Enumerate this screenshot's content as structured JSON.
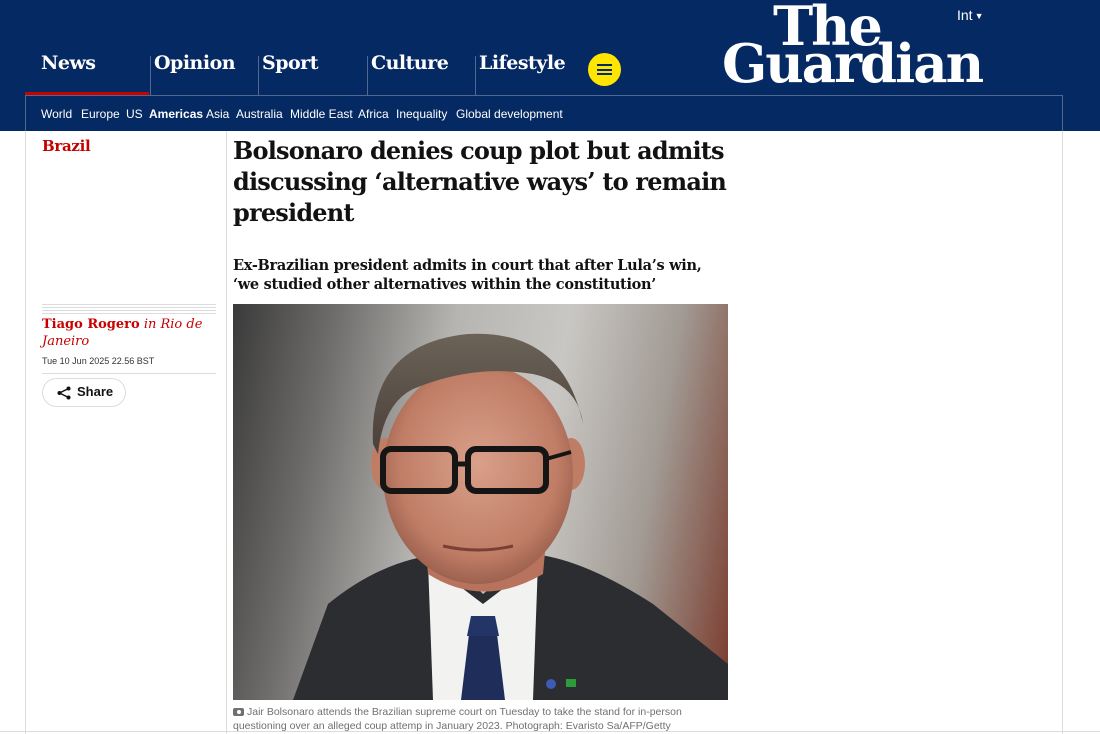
{
  "header": {
    "edition": "Int",
    "logo_line1": "The",
    "logo_line2": "Guardian",
    "colors": {
      "brand": "#052962",
      "news_accent": "#c70000",
      "menu_button": "#ffe500"
    },
    "pillars": [
      {
        "label": "News",
        "active": true
      },
      {
        "label": "Opinion"
      },
      {
        "label": "Sport"
      },
      {
        "label": "Culture"
      },
      {
        "label": "Lifestyle"
      }
    ],
    "menu_icon": "hamburger-icon",
    "subnav": [
      {
        "label": "World"
      },
      {
        "label": "Europe"
      },
      {
        "label": "US"
      },
      {
        "label": "Americas",
        "active": true
      },
      {
        "label": "Asia"
      },
      {
        "label": "Australia"
      },
      {
        "label": "Middle East"
      },
      {
        "label": "Africa"
      },
      {
        "label": "Inequality"
      },
      {
        "label": "Global development"
      }
    ]
  },
  "article": {
    "section": "Brazil",
    "headline": "Bolsonaro denies coup plot but admits discussing ‘alternative ways’ to remain president",
    "standfirst": "Ex-Brazilian president admits in court that after Lula’s win, ‘we studied other alternatives within the constitution’",
    "byline": {
      "author": "Tiago Rogero",
      "in": " in ",
      "location": "Rio de Janeiro"
    },
    "date": "Tue 10 Jun 2025 22.56 BST",
    "share_label": "Share",
    "share_icon": "share-icon",
    "caption_icon": "camera-icon",
    "caption": "Jair Bolsonaro attends the Brazilian supreme court on Tuesday to take the stand for in-person questioning over an alleged coup attemp in January 2023. Photograph: Evaristo Sa/AFP/Getty"
  }
}
